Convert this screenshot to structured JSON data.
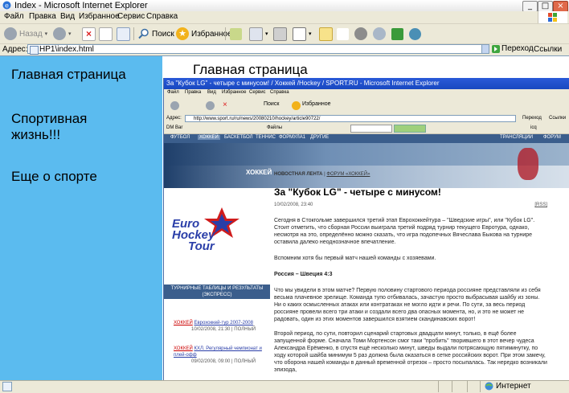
{
  "window": {
    "title": "Index - Microsoft Internet Explorer"
  },
  "menu": [
    "Файл",
    "Правка",
    "Вид",
    "Избранное",
    "Сервис",
    "Справка"
  ],
  "toolbar": {
    "back": "Назад",
    "search": "Поиск",
    "favorites": "Избранное"
  },
  "address": {
    "label": "Адрес:",
    "url": "HP1\\index.html",
    "go": "Переход",
    "links": "Ссылки"
  },
  "sidebar": {
    "items": [
      "Главная страница",
      "Спортивная жизнь!!!",
      "Еще о спорте"
    ]
  },
  "page": {
    "heading": "Главная страница"
  },
  "inner": {
    "window_title": "За \"Кубок LG\" - четыре с минусом! / Хоккей /Hockey / SPORT.RU - Microsoft Internet Explorer",
    "menu": [
      "Файл",
      "Правка",
      "Вид",
      "Избранное",
      "Сервис",
      "Справка"
    ],
    "address_label": "Адрес:",
    "url": "http://www.sport.ru/ru/news/20080210/hockey/article90722/",
    "go": "Переход",
    "links": "Ссылки",
    "dm_bar": "DM Bar",
    "files": "Файлы",
    "icq": "icq",
    "nav_items": [
      "ФУТБОЛ",
      "ХОККЕЙ",
      "БАСКЕТБОЛ",
      "ТЕННИС",
      "ФОРМУЛА1",
      "ДРУГИЕ"
    ],
    "nav_right": [
      "ТРАНСЛЯЦИИ",
      "ФОРУМ"
    ],
    "banner_label": "ХОККЕЙ",
    "crumb_strong": "НОВОСТНАЯ ЛЕНТА",
    "crumb_link": "ФОРУМ «ХОККЕЙ»",
    "logo": [
      "Euro",
      "Hockey",
      "Tour"
    ],
    "tables_header": "ТУРНИРНЫЕ ТАБЛИЦЫ И РЕЗУЛЬТАТЫ (ЭКСПРЕСС)",
    "news": [
      {
        "tag": "ХОККЕЙ",
        "title": "Еврохоккей-тур 2007-2008",
        "date": "10/02/2008, 21:30 |",
        "tail": "ПОЛНЫЙ"
      },
      {
        "tag": "ХОККЕЙ",
        "title": "КХЛ. Регулярный чемпионат и плей-офф",
        "date": "09/02/2008, 09:00 |",
        "tail": "ПОЛНЫЙ"
      }
    ],
    "article": {
      "title": "За \"Кубок LG\" - четыре с минусом!",
      "date": "10/02/2008, 23:40",
      "rss": "[RSS]",
      "p1": "Сегодня в Стокгольме завершился третий этап Еврохоккейтура – \"Шведские игры\", или \"Кубок LG\". Стоит отметить, что сборная России выиграла третий подряд турнир текущего Евротура, однако, несмотря на это, определённо можно сказать, что игра подопечных Вячеслава Быкова на турнире оставила далеко неоднозначное впечатление.",
      "p2": "Вспомним хотя бы первый матч нашей команды с хозяевами.",
      "subhead": "Россия – Швеция 4:3",
      "p3": "Что мы увидели в этом матче? Первую половину стартового периода россияне представляли из себя весьма плачевное зрелище. Команда тупо отбивалась, зачастую просто выбрасывая шайбу из зоны. Ни о каких осмысленных атаках или контратаках не могло идти и речи. По сути, за весь период россияне провели всего три атаки и создали всего два опасных момента, но, и это не может не радовать, один из этих моментов завершился взятием скандинавских ворот!",
      "p4": "Второй период, по сути, повторил сценарий стартовых двадцати минут, только, в ещё более запущенной форме. Сначала Томи Мортенсон смог таки \"пробить\" творившего в этот вечер чудеса Александра Ерёменко, в спустя ещё несколько минут, шведы выдали потрясающую пятиминутку, по ходу которой шайба минимум 5 раз должна была оказаться в сетке российских ворот. При этом замечу, что оборона нашей команды в данный временной отрезок – просто посыпалась. Так нередко возникали эпизода,"
    }
  },
  "status": {
    "zone": "Интернет"
  },
  "colors": {
    "sidebar": "#5bbbef",
    "ie_blue": "#1848c0",
    "nav": "#3b5e8c",
    "logo_blue": "#2a3ea8",
    "logo_red": "#d01c1c"
  }
}
